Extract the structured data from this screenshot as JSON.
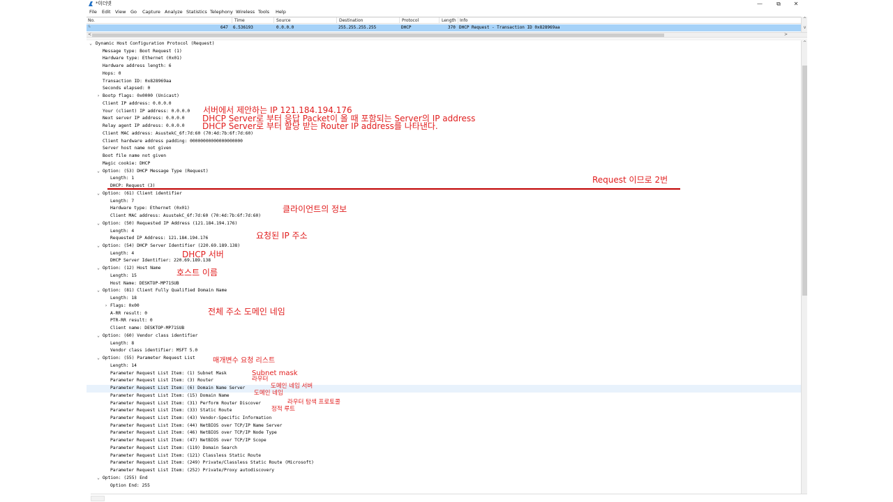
{
  "window": {
    "title": "*이더넷",
    "controls": [
      "—",
      "⧉",
      "✕"
    ]
  },
  "menu": [
    "File",
    "Edit",
    "View",
    "Go",
    "Capture",
    "Analyze",
    "Statistics",
    "Telephony",
    "Wireless",
    "Tools",
    "Help"
  ],
  "packet_list": {
    "columns": [
      "No.",
      "Time",
      "Source",
      "Destination",
      "Protocol",
      "Length",
      "Info"
    ],
    "row": {
      "no": "647",
      "time": "6.536193",
      "source": "0.0.0.0",
      "destination": "255.255.255.255",
      "protocol": "DHCP",
      "length": "370",
      "info": "DHCP Request  - Transaction ID 0x828969aa"
    }
  },
  "detail_lines": [
    {
      "t": "Dynamic Host Configuration Protocol (Request)",
      "l": 0,
      "c": "open"
    },
    {
      "t": "Message type: Boot Request (1)",
      "l": 1
    },
    {
      "t": "Hardware type: Ethernet (0x01)",
      "l": 1
    },
    {
      "t": "Hardware address length: 6",
      "l": 1
    },
    {
      "t": "Hops: 0",
      "l": 1
    },
    {
      "t": "Transaction ID: 0x828969aa",
      "l": 1
    },
    {
      "t": "Seconds elapsed: 0",
      "l": 1
    },
    {
      "t": "Bootp flags: 0x0000 (Unicast)",
      "l": 1,
      "c": "closed"
    },
    {
      "t": "Client IP address: 0.0.0.0",
      "l": 1
    },
    {
      "t": "Your (client) IP address: 0.0.0.0",
      "l": 1
    },
    {
      "t": "Next server IP address: 0.0.0.0",
      "l": 1
    },
    {
      "t": "Relay agent IP address: 0.0.0.0",
      "l": 1
    },
    {
      "t": "Client MAC address: AsustekC_6f:7d:60 (70:4d:7b:6f:7d:60)",
      "l": 1
    },
    {
      "t": "Client hardware address padding: 00000000000000000000",
      "l": 1
    },
    {
      "t": "Server host name not given",
      "l": 1
    },
    {
      "t": "Boot file name not given",
      "l": 1
    },
    {
      "t": "Magic cookie: DHCP",
      "l": 1
    },
    {
      "t": "Option: (53) DHCP Message Type (Request)",
      "l": 1,
      "c": "open"
    },
    {
      "t": "Length: 1",
      "l": 2
    },
    {
      "t": "DHCP: Request (3)",
      "l": 2
    },
    {
      "t": "Option: (61) Client identifier",
      "l": 1,
      "c": "open"
    },
    {
      "t": "Length: 7",
      "l": 2
    },
    {
      "t": "Hardware type: Ethernet (0x01)",
      "l": 2
    },
    {
      "t": "Client MAC address: AsustekC_6f:7d:60 (70:4d:7b:6f:7d:60)",
      "l": 2
    },
    {
      "t": "Option: (50) Requested IP Address (121.184.194.176)",
      "l": 1,
      "c": "open"
    },
    {
      "t": "Length: 4",
      "l": 2
    },
    {
      "t": "Requested IP Address: 121.184.194.176",
      "l": 2
    },
    {
      "t": "Option: (54) DHCP Server Identifier (220.69.189.138)",
      "l": 1,
      "c": "open"
    },
    {
      "t": "Length: 4",
      "l": 2
    },
    {
      "t": "DHCP Server Identifier: 220.69.189.138",
      "l": 2
    },
    {
      "t": "Option: (12) Host Name",
      "l": 1,
      "c": "open"
    },
    {
      "t": "Length: 15",
      "l": 2
    },
    {
      "t": "Host Name: DESKTOP-MP71SUB",
      "l": 2
    },
    {
      "t": "Option: (81) Client Fully Qualified Domain Name",
      "l": 1,
      "c": "open"
    },
    {
      "t": "Length: 18",
      "l": 2
    },
    {
      "t": "Flags: 0x00",
      "l": 2,
      "c": "closed"
    },
    {
      "t": "A-RR result: 0",
      "l": 2
    },
    {
      "t": "PTR-RR result: 0",
      "l": 2
    },
    {
      "t": "Client name: DESKTOP-MP71SUB",
      "l": 2
    },
    {
      "t": "Option: (60) Vendor class identifier",
      "l": 1,
      "c": "open"
    },
    {
      "t": "Length: 8",
      "l": 2
    },
    {
      "t": "Vendor class identifier: MSFT 5.0",
      "l": 2
    },
    {
      "t": "Option: (55) Parameter Request List",
      "l": 1,
      "c": "open"
    },
    {
      "t": "Length: 14",
      "l": 2
    },
    {
      "t": "Parameter Request List Item: (1) Subnet Mask",
      "l": 2
    },
    {
      "t": "Parameter Request List Item: (3) Router",
      "l": 2
    },
    {
      "t": "Parameter Request List Item: (6) Domain Name Server",
      "l": 2,
      "sel": true
    },
    {
      "t": "Parameter Request List Item: (15) Domain Name",
      "l": 2
    },
    {
      "t": "Parameter Request List Item: (31) Perform Router Discover",
      "l": 2
    },
    {
      "t": "Parameter Request List Item: (33) Static Route",
      "l": 2
    },
    {
      "t": "Parameter Request List Item: (43) Vendor-Specific Information",
      "l": 2
    },
    {
      "t": "Parameter Request List Item: (44) NetBIOS over TCP/IP Name Server",
      "l": 2
    },
    {
      "t": "Parameter Request List Item: (46) NetBIOS over TCP/IP Node Type",
      "l": 2
    },
    {
      "t": "Parameter Request List Item: (47) NetBIOS over TCP/IP Scope",
      "l": 2
    },
    {
      "t": "Parameter Request List Item: (119) Domain Search",
      "l": 2
    },
    {
      "t": "Parameter Request List Item: (121) Classless Static Route",
      "l": 2
    },
    {
      "t": "Parameter Request List Item: (249) Private/Classless Static Route (Microsoft)",
      "l": 2
    },
    {
      "t": "Parameter Request List Item: (252) Private/Proxy autodiscovery",
      "l": 2
    },
    {
      "t": "Option: (255) End",
      "l": 1,
      "c": "open"
    },
    {
      "t": "Option End: 255",
      "l": 2
    }
  ],
  "annotations": {
    "offered_ip": "서버에서 제안하는 IP 121.184.194.176",
    "next_server": "DHCP Server로 부터 응답 Packet이 올 때 포함되는 Server의 IP address",
    "relay_agent": "DHCP Server로 부터 할당 받는 Router IP address를 나타낸다.",
    "request_num": "Request 이므로 2번",
    "client_info": "클라이언트의 정보",
    "requested_ip": "요청된 IP 주소",
    "dhcp_server": "DHCP 서버",
    "host_name": "호스트 이름",
    "fqdn": "전체 주소 도메인 네임",
    "param_list": "매개변수 요청 리스트",
    "subnet_mask": "Subnet mask",
    "router": "라우터",
    "dns": "도메인 네임 서버",
    "domain_name": "도메인 네임",
    "router_discovery": "라우터 탐색 프로토콜",
    "static_route": "정적 루트"
  },
  "colors": {
    "selected_row": "#a6d2f8",
    "annotation": "#e11e1e",
    "underline": "#c00000"
  }
}
